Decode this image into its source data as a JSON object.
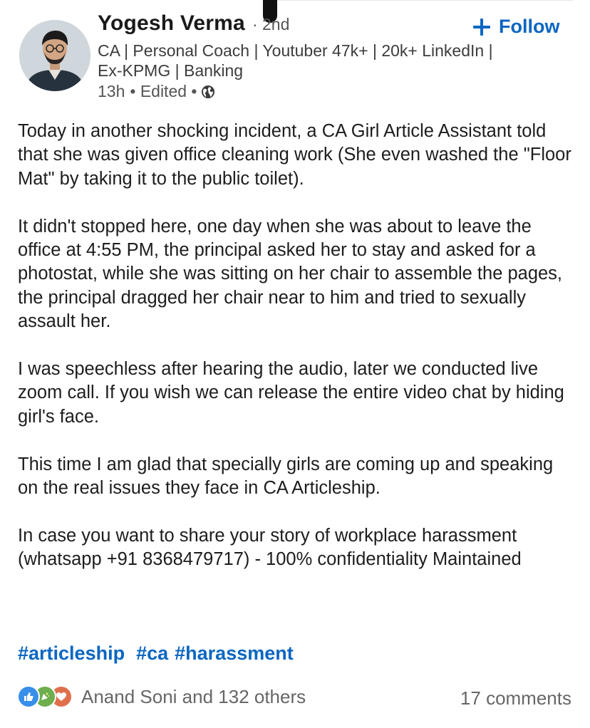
{
  "author": {
    "name": "Yogesh Verma",
    "degree": "· 2nd",
    "headline": "CA | Personal Coach | Youtuber 47k+ | 20k+ LinkedIn | Ex-KPMG | Banking",
    "time": "13h",
    "edited": "• Edited •"
  },
  "follow_label": "Follow",
  "post": {
    "paragraphs": [
      "Today in another shocking incident, a CA Girl Article Assistant told that she was given office cleaning work (She even washed the \"Floor Mat\" by taking it to the public toilet).",
      "It didn't stopped here, one day when she was about to leave the office at 4:55 PM, the principal asked her to stay and asked for a photostat, while she was sitting on her chair to assemble the pages, the principal dragged her chair near to him and tried to sexually assault her.",
      "I was speechless after hearing the audio, later we conducted live zoom call. If you wish we can release the entire video chat by hiding girl's face.",
      "This time I am glad that specially girls are coming up and speaking on the real issues they face in CA Articleship.",
      "In case you want to share your story of workplace harassment (whatsapp +91 8368479717) - 100% confidentiality Maintained"
    ],
    "hashtags": [
      "#articleship",
      "#ca",
      "#harassment"
    ]
  },
  "social": {
    "reaction_icons": [
      "like-icon",
      "celebrate-icon",
      "love-icon"
    ],
    "reactions_text": "Anand Soni and 132 others",
    "comments_text": "17 comments"
  },
  "colors": {
    "link_blue": "#0a66c2",
    "like": "#378fe9",
    "celebrate": "#6dae4f",
    "love": "#df704d"
  }
}
